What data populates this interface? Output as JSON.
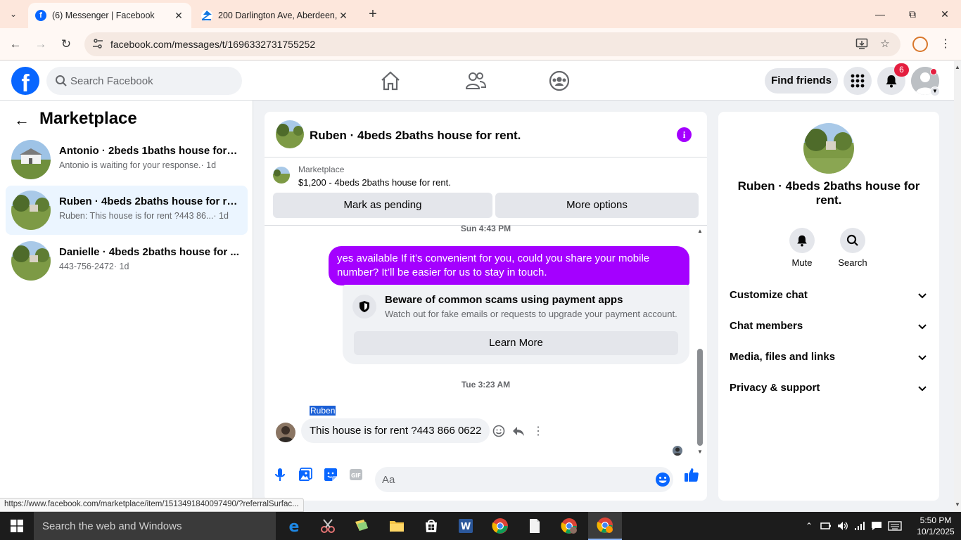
{
  "browser": {
    "tabs": [
      {
        "title": "(6) Messenger | Facebook",
        "active": true
      },
      {
        "title": "200 Darlington Ave, Aberdeen,",
        "active": false
      }
    ],
    "url": "facebook.com/messages/t/1696332731755252",
    "status_url": "https://www.facebook.com/marketplace/item/1513491840097490/?referralSurfac..."
  },
  "facebook": {
    "search_placeholder": "Search Facebook",
    "find_friends_label": "Find friends",
    "notification_count": "6"
  },
  "sidebar": {
    "title": "Marketplace",
    "conversations": [
      {
        "name": "Antonio · 2beds 1baths house for r...",
        "preview": "Antonio is waiting for your response.",
        "time": "· 1d",
        "selected": false
      },
      {
        "name": "Ruben · 4beds 2baths house for re...",
        "preview": "Ruben: This house is for rent ?443 86...",
        "time": "· 1d",
        "selected": true
      },
      {
        "name": "Danielle · 4beds 2baths house for ...",
        "preview": "443-756-2472",
        "time": "· 1d",
        "selected": false
      }
    ]
  },
  "chat": {
    "title": "Ruben · 4beds 2baths house for rent.",
    "listing": {
      "category": "Marketplace",
      "price_title": "$1,200 - 4beds 2baths house for rent.",
      "mark_pending_label": "Mark as pending",
      "more_options_label": "More options"
    },
    "timestamp_1": "Sun 4:43 PM",
    "outgoing_message": "yes available If it’s convenient for you, could you share your mobile number? It’ll be easier for us to stay in touch.",
    "scam_warning": {
      "title": "Beware of common scams using payment apps",
      "description": "Watch out for fake emails or requests to upgrade your payment account.",
      "learn_more_label": "Learn More"
    },
    "timestamp_2": "Tue 3:23 AM",
    "sender_name": "Ruben",
    "incoming_message": "This house is for rent ?443 866 0622",
    "composer_placeholder": "Aa"
  },
  "info_panel": {
    "name": "Ruben · 4beds 2baths house for rent.",
    "actions": [
      {
        "label": "Mute",
        "icon": "bell-icon"
      },
      {
        "label": "Search",
        "icon": "search-icon"
      }
    ],
    "sections": [
      {
        "label": "Customize chat"
      },
      {
        "label": "Chat members"
      },
      {
        "label": "Media, files and links"
      },
      {
        "label": "Privacy & support"
      }
    ]
  },
  "taskbar": {
    "search_placeholder": "Search the web and Windows",
    "time": "5:50 PM",
    "date": "10/1/2025"
  },
  "colors": {
    "facebook_blue": "#0866ff",
    "messenger_purple": "#a400ff",
    "notification_red": "#e41e3f",
    "tab_bar": "#fde7dc"
  }
}
